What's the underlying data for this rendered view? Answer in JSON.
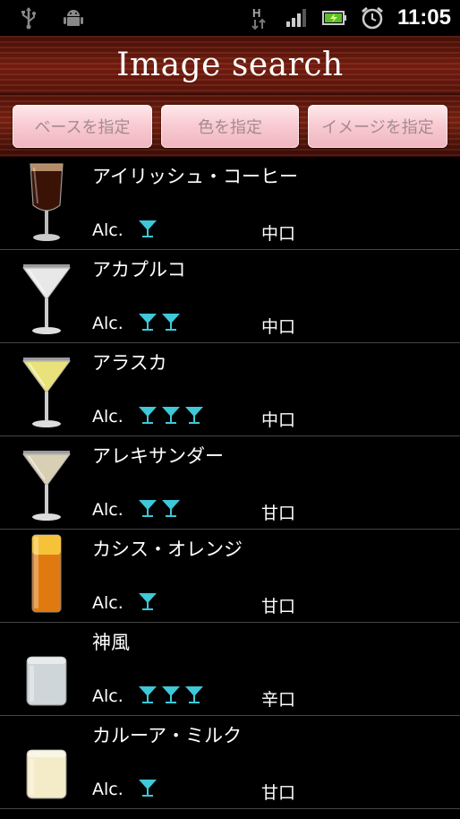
{
  "statusbar": {
    "time": "11:05",
    "network": "H"
  },
  "header": {
    "title": "Image search"
  },
  "buttons": [
    {
      "label": "ベースを指定"
    },
    {
      "label": "色を指定"
    },
    {
      "label": "イメージを指定"
    }
  ],
  "list": {
    "alc_label": "Alc.",
    "items": [
      {
        "name": "アイリッシュ・コーヒー",
        "alcohol": 1,
        "taste": "中口",
        "drink_color": "#3a1206",
        "glass": "irish"
      },
      {
        "name": "アカプルコ",
        "alcohol": 2,
        "taste": "中口",
        "drink_color": "#e8e8e8",
        "glass": "cocktail"
      },
      {
        "name": "アラスカ",
        "alcohol": 3,
        "taste": "中口",
        "drink_color": "#e9e27a",
        "glass": "cocktail"
      },
      {
        "name": "アレキサンダー",
        "alcohol": 2,
        "taste": "甘口",
        "drink_color": "#d8cfb5",
        "glass": "cocktail"
      },
      {
        "name": "カシス・オレンジ",
        "alcohol": 1,
        "taste": "甘口",
        "drink_color": "#e07a10",
        "glass": "tall"
      },
      {
        "name": "神風",
        "alcohol": 3,
        "taste": "辛口",
        "drink_color": "#cfd6d9",
        "glass": "rocks"
      },
      {
        "name": "カルーア・ミルク",
        "alcohol": 1,
        "taste": "甘口",
        "drink_color": "#f4ecc8",
        "glass": "rocks"
      }
    ]
  },
  "colors": {
    "glass_icon": "#3ec8d8",
    "button_text": "#a48b8e",
    "header_wood": "#6a1a0c"
  }
}
